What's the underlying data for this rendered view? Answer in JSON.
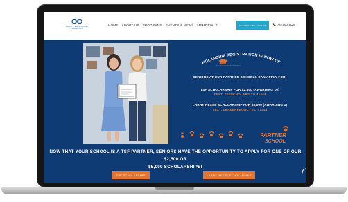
{
  "nav": {
    "logo_text": "TRIBUTE SCHOLARSHIP FOUNDATION",
    "menu": [
      "HOME",
      "ABOUT US",
      "PROGRAMS",
      "EVENTS & NEWS",
      "MEMORIALS"
    ],
    "cta_left": "GET INFO NOW",
    "cta_right": "DONATE",
    "phone": "732-860-1329"
  },
  "hero": {
    "title": "SCHOLARSHIP REGISTRATION IS NOW OPEN!",
    "mini_logo": "TRIBUTE SCHOLARSHIP FOUNDATION",
    "seniors_line": "SENIORS AT OUR PARTNER SCHOOLS CAN APPLY FOR:",
    "tsf_line": "TSF SCHOLARSHIP FOR $2,500 (AWARDING 10)",
    "tsf_text": "TEXT: TSFSCHOLARS TO 41444",
    "larry_line": "LARRY HESSE SCHOLARSHIP FOR $5,000 (AWARDING 1)",
    "larry_text": "TEXT: LEADERLEGACY TO 41444",
    "partner_badge_1": "PARTNER",
    "partner_badge_2": "SCHOOL",
    "headline_1": "NOW THAT YOUR SCHOOL IS A TSF PARTNER, SENIORS HAVE THE OPPORTUNITY TO APPLY FOR ONE OF OUR $2,500 OR",
    "headline_2": "$5,000 SCHOLARSHIPS!",
    "cta_tsf": "TSF SCHOLARSHIP",
    "cta_larry": "LARRY HESSE SCHOLARSHIP"
  },
  "colors": {
    "page_bg": "#0f3b75",
    "accent_orange": "#e8732c",
    "accent_teal": "#26a6c9"
  }
}
